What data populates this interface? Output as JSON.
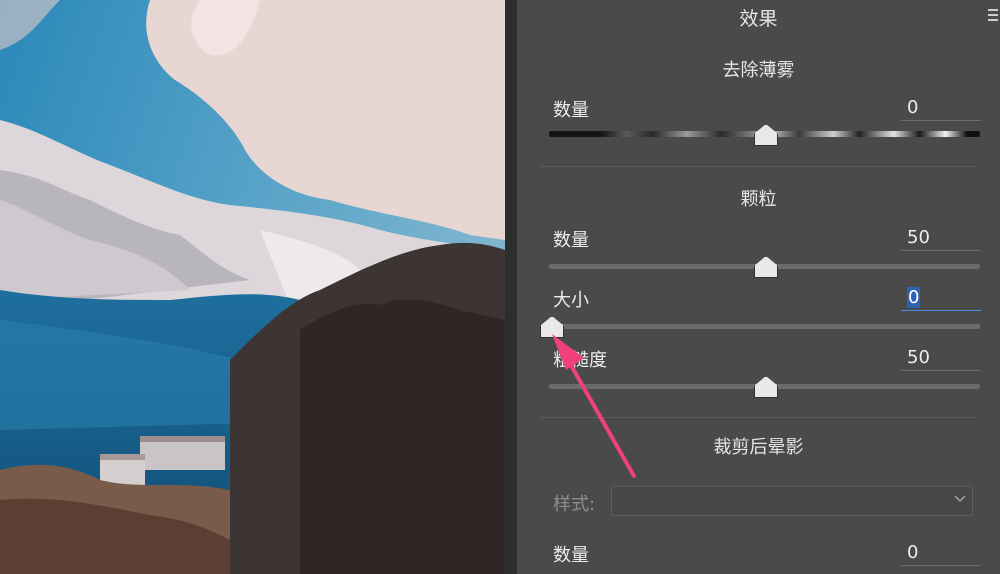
{
  "panel": {
    "title": "效果",
    "menu_icon": "hamburger-menu-icon",
    "dehaze": {
      "title": "去除薄雾",
      "amount": {
        "label": "数量",
        "value": "0",
        "position": 0.5
      }
    },
    "grain": {
      "title": "颗粒",
      "amount": {
        "label": "数量",
        "value": "50",
        "position": 0.5
      },
      "size": {
        "label": "大小",
        "value": "0",
        "position": 0.0
      },
      "roughness": {
        "label": "粗糙度",
        "value": "50",
        "position": 0.5
      }
    },
    "vignette": {
      "title": "裁剪后晕影",
      "style": {
        "label": "样式:",
        "value": ""
      },
      "amount": {
        "label": "数量",
        "value": "0",
        "position": 0.5
      }
    }
  },
  "photo": {
    "subject": "snowy mountain landscape"
  },
  "annotation": {
    "icon": "pink-arrow-icon",
    "color": "#f0407e"
  },
  "colors": {
    "panel_bg": "#4a4a4a",
    "text": "#e9e9e9",
    "accent": "#2f62b3"
  }
}
